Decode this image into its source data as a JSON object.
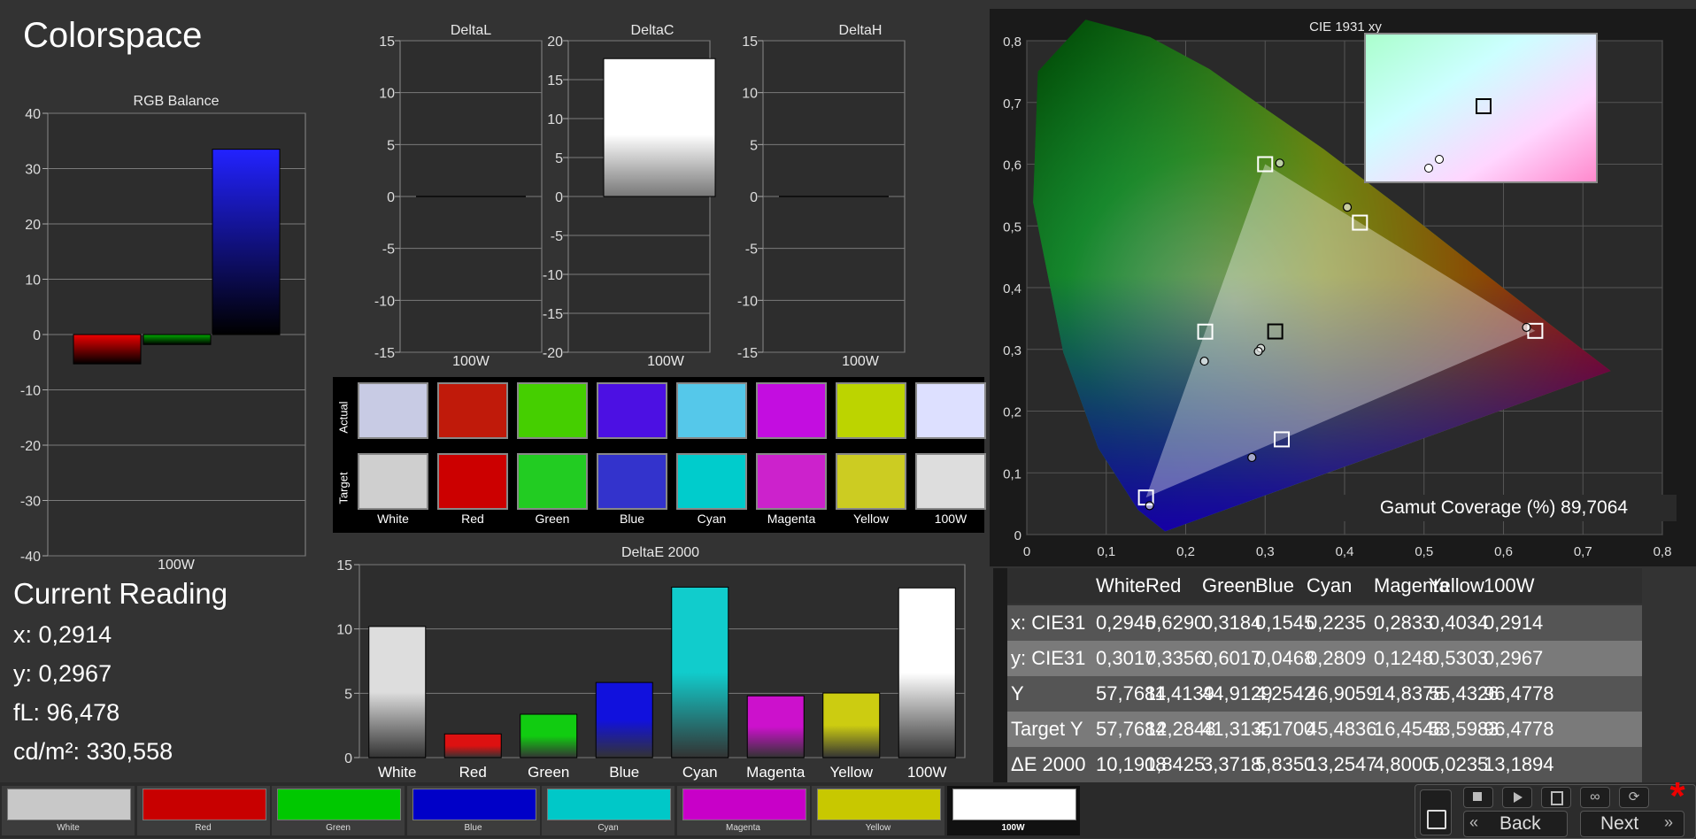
{
  "app": {
    "title": "Colorspace"
  },
  "rgb_balance": {
    "title": "RGB Balance",
    "xlabel": "100W"
  },
  "delta_charts": [
    {
      "title": "DeltaL",
      "xlabel": "100W"
    },
    {
      "title": "DeltaC",
      "xlabel": "100W"
    },
    {
      "title": "DeltaH",
      "xlabel": "100W"
    }
  ],
  "swatches": {
    "actual_label": "Actual",
    "target_label": "Target",
    "items": [
      {
        "label": "White",
        "actual": "#c8cbe4",
        "target": "#cfcfcf"
      },
      {
        "label": "Red",
        "actual": "#c01a0a",
        "target": "#cc0000"
      },
      {
        "label": "Green",
        "actual": "#45cf00",
        "target": "#22cc22"
      },
      {
        "label": "Blue",
        "actual": "#4c10e3",
        "target": "#3333cc"
      },
      {
        "label": "Cyan",
        "actual": "#55c8ea",
        "target": "#00cccc"
      },
      {
        "label": "Magenta",
        "actual": "#c30de0",
        "target": "#cc22cc"
      },
      {
        "label": "Yellow",
        "actual": "#bcd400",
        "target": "#cccc22"
      },
      {
        "label": "100W",
        "actual": "#dde0ff",
        "target": "#dddddd"
      }
    ]
  },
  "deltae": {
    "title": "DeltaE 2000"
  },
  "cie": {
    "title": "CIE 1931 xy",
    "gamut_label": "Gamut Coverage (%) 89,7064"
  },
  "current_reading": {
    "heading": "Current Reading",
    "x": "x: 0,2914",
    "y": "y: 0,2967",
    "fl": "fL: 96,478",
    "cdm2": "cd/m²: 330,558"
  },
  "table": {
    "columns": [
      "",
      "White",
      "Red",
      "Green",
      "Blue",
      "Cyan",
      "Magenta",
      "Yellow",
      "100W"
    ],
    "rows": [
      {
        "label": "x: CIE31",
        "values": [
          "0,2945",
          "0,6290",
          "0,3184",
          "0,1545",
          "0,2235",
          "0,2833",
          "0,4034",
          "0,2914"
        ]
      },
      {
        "label": "y: CIE31",
        "values": [
          "0,3017",
          "0,3356",
          "0,6017",
          "0,0468",
          "0,2809",
          "0,1248",
          "0,5303",
          "0,2967"
        ]
      },
      {
        "label": "Y",
        "values": [
          "57,7684",
          "11,4139",
          "44,9129",
          "4,2542",
          "46,9059",
          "14,8378",
          "55,4326",
          "96,4778"
        ]
      },
      {
        "label": "Target Y",
        "values": [
          "57,7684",
          "12,2848",
          "41,3135",
          "4,1700",
          "45,4836",
          "16,4548",
          "53,5983",
          "96,4778"
        ]
      },
      {
        "label": "ΔE 2000",
        "values": [
          "10,1908",
          "1,8425",
          "3,3718",
          "5,8350",
          "13,2547",
          "4,8000",
          "5,0235",
          "13,1894"
        ]
      }
    ]
  },
  "tabs": [
    {
      "label": "White",
      "color": "#c8c8c8"
    },
    {
      "label": "Red",
      "color": "#c80000"
    },
    {
      "label": "Green",
      "color": "#00c800"
    },
    {
      "label": "Blue",
      "color": "#0000c8"
    },
    {
      "label": "Cyan",
      "color": "#00c8c8"
    },
    {
      "label": "Magenta",
      "color": "#c800c8"
    },
    {
      "label": "Yellow",
      "color": "#c8c800"
    },
    {
      "label": "100W",
      "color": "#ffffff"
    }
  ],
  "nav": {
    "back_label": "Back",
    "next_label": "Next"
  },
  "chart_data": [
    {
      "type": "bar",
      "title": "RGB Balance",
      "categories": [
        "100W"
      ],
      "series": [
        {
          "values": [
            -5.3
          ],
          "color": "#ee0000"
        },
        {
          "values": [
            -1.8
          ],
          "color": "#00aa00"
        },
        {
          "values": [
            33.5
          ],
          "color": "#2222ff"
        }
      ],
      "ylim": [
        -40,
        40
      ],
      "yticks": [
        40,
        30,
        20,
        10,
        0,
        -10,
        -20,
        -30,
        -40
      ],
      "xlabel": "100W"
    },
    {
      "type": "bar",
      "title": "DeltaL",
      "categories": [
        "100W"
      ],
      "values": [
        0
      ],
      "ylim": [
        -15,
        15
      ],
      "yticks": [
        15,
        10,
        5,
        0,
        -5,
        -10,
        -15
      ]
    },
    {
      "type": "bar",
      "title": "DeltaC",
      "categories": [
        "100W"
      ],
      "values": [
        17.7
      ],
      "ylim": [
        -20,
        20
      ],
      "yticks": [
        20,
        15,
        10,
        5,
        0,
        -5,
        -10,
        -15,
        -20
      ]
    },
    {
      "type": "bar",
      "title": "DeltaH",
      "categories": [
        "100W"
      ],
      "values": [
        0
      ],
      "ylim": [
        -15,
        15
      ],
      "yticks": [
        15,
        10,
        5,
        0,
        -5,
        -10,
        -15
      ]
    },
    {
      "type": "bar",
      "title": "DeltaE 2000",
      "categories": [
        "White",
        "Red",
        "Green",
        "Blue",
        "Cyan",
        "Magenta",
        "Yellow",
        "100W"
      ],
      "values": [
        10.19,
        1.84,
        3.37,
        5.84,
        13.25,
        4.8,
        5.02,
        13.19
      ],
      "colors": [
        "#dddddd",
        "#dd1111",
        "#11cc11",
        "#1111dd",
        "#11cccc",
        "#cc11cc",
        "#cccc11",
        "#ffffff"
      ],
      "ylim": [
        0,
        15
      ],
      "yticks": [
        15,
        10,
        5,
        0
      ]
    },
    {
      "type": "scatter",
      "title": "CIE 1931 xy",
      "xlim": [
        0,
        0.8
      ],
      "ylim": [
        0,
        0.8
      ],
      "xticks": [
        "0",
        "0,1",
        "0,2",
        "0,3",
        "0,4",
        "0,5",
        "0,6",
        "0,7",
        "0,8"
      ],
      "yticks": [
        "0",
        "0,1",
        "0,2",
        "0,3",
        "0,4",
        "0,5",
        "0,6",
        "0,7",
        "0,8"
      ],
      "target_points": [
        [
          0.3127,
          0.329
        ],
        [
          0.64,
          0.33
        ],
        [
          0.3,
          0.6
        ],
        [
          0.15,
          0.06
        ],
        [
          0.2246,
          0.3287
        ],
        [
          0.3209,
          0.1542
        ],
        [
          0.4193,
          0.5053
        ]
      ],
      "actual_points": [
        [
          0.2945,
          0.3017
        ],
        [
          0.629,
          0.3356
        ],
        [
          0.3184,
          0.6017
        ],
        [
          0.1545,
          0.0468
        ],
        [
          0.2235,
          0.2809
        ],
        [
          0.2833,
          0.1248
        ],
        [
          0.4034,
          0.5303
        ],
        [
          0.2914,
          0.2967
        ]
      ]
    }
  ]
}
